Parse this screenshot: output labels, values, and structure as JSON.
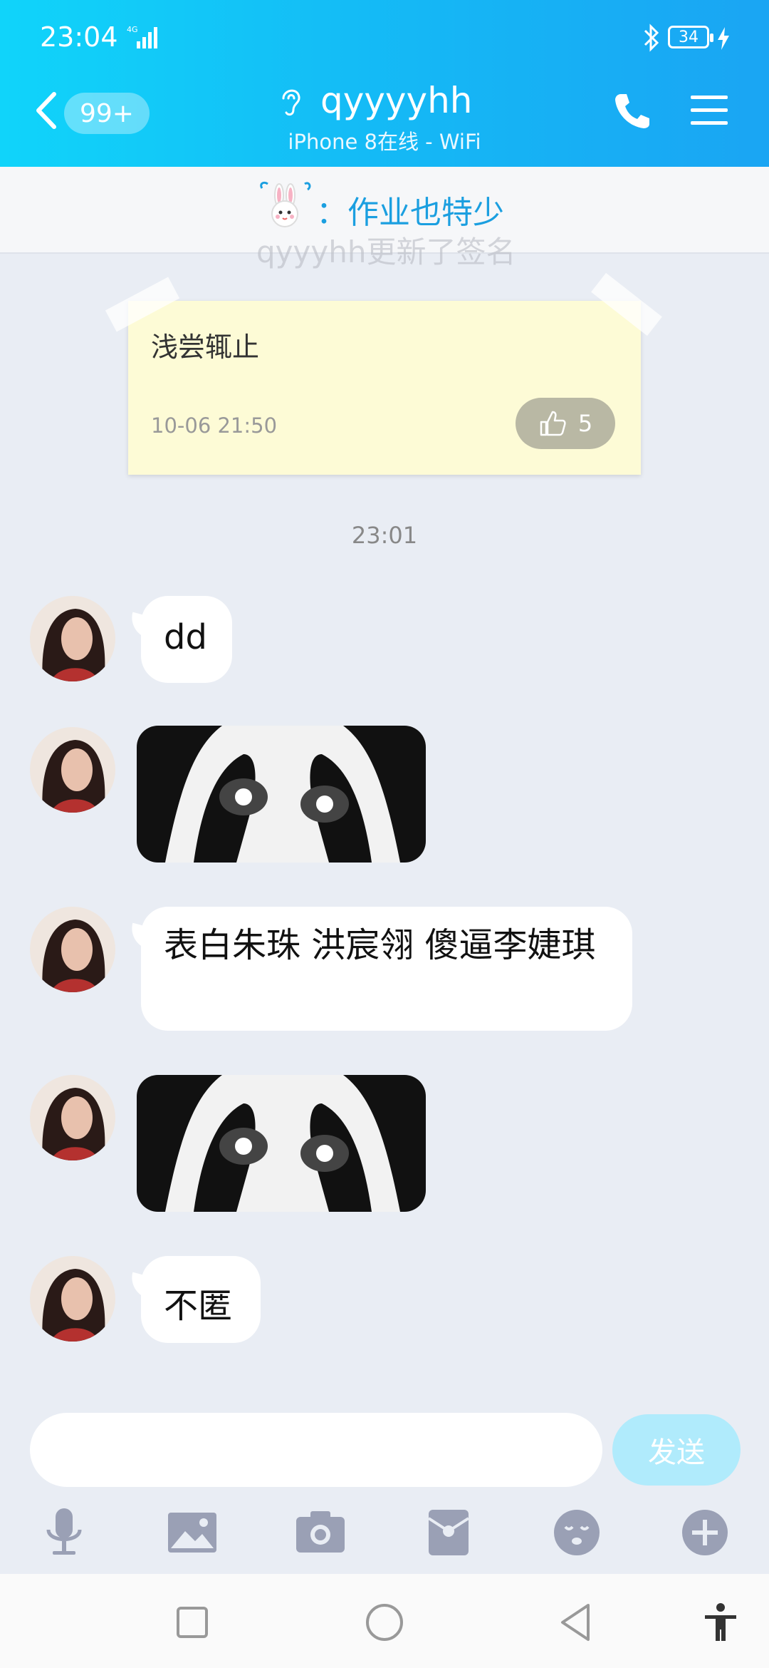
{
  "status_bar": {
    "time": "23:04",
    "battery": "34",
    "network": "4G"
  },
  "header": {
    "unread_badge": "99+",
    "contact_name": "qyyyyhh",
    "contact_status": "iPhone 8在线 - WiFi"
  },
  "pinned": {
    "text": "：作业也特少",
    "ghost_text": "qyyyhh更新了签名"
  },
  "note": {
    "text": "浅尝辄止",
    "date": "10-06 21:50",
    "likes": "5"
  },
  "chat": {
    "timestamp": "23:01",
    "messages": [
      {
        "type": "text",
        "text": "dd"
      },
      {
        "type": "image",
        "description": "meme-image"
      },
      {
        "type": "text",
        "text": "表白朱珠 洪宸翎 傻逼李婕琪"
      },
      {
        "type": "image",
        "description": "meme-image"
      },
      {
        "type": "text",
        "text": "不匿"
      }
    ]
  },
  "input": {
    "placeholder": "",
    "send_label": "发送"
  },
  "toolbar": {
    "items": [
      "microphone-icon",
      "image-icon",
      "camera-icon",
      "red-envelope-icon",
      "emoji-icon",
      "plus-icon"
    ]
  },
  "colors": {
    "header_start": "#10d4fa",
    "header_end": "#1aa5f3",
    "accent": "#1b9fe0",
    "send_disabled": "#b0ebfc",
    "chat_bg": "#e9edf4"
  }
}
